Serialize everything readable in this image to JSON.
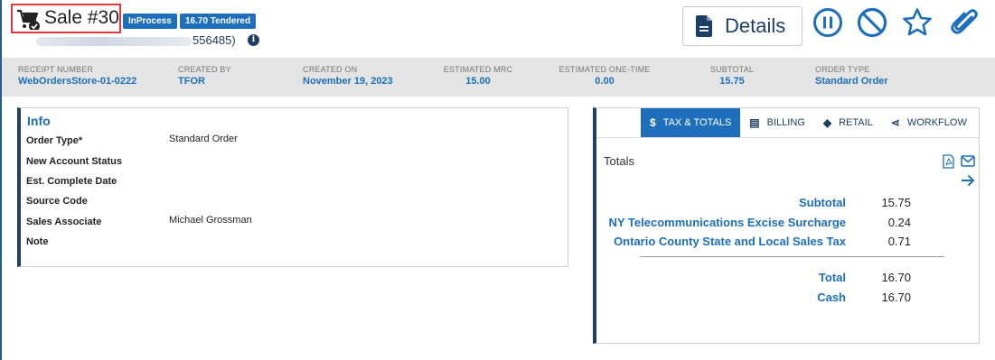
{
  "header": {
    "title": "Sale #30",
    "status_badge": "InProcess",
    "tendered_badge": "16.70 Tendered",
    "customer_suffix": "556485)",
    "details_label": "Details"
  },
  "summary": [
    {
      "label": "RECEIPT NUMBER",
      "value": "WebOrdersStore-01-0222"
    },
    {
      "label": "CREATED BY",
      "value": "TFOR"
    },
    {
      "label": "CREATED ON",
      "value": "November 19, 2023"
    },
    {
      "label": "ESTIMATED MRC",
      "value": "15.00"
    },
    {
      "label": "ESTIMATED ONE-TIME",
      "value": "0.00"
    },
    {
      "label": "SUBTOTAL",
      "value": "15.75"
    },
    {
      "label": "ORDER TYPE",
      "value": "Standard Order"
    }
  ],
  "info": {
    "title": "Info",
    "rows": [
      {
        "label": "Order Type*",
        "value": "Standard Order"
      },
      {
        "label": "New Account Status",
        "value": ""
      },
      {
        "label": "Est. Complete Date",
        "value": ""
      },
      {
        "label": "Source Code",
        "value": ""
      },
      {
        "label": "Sales Associate",
        "value": "Michael Grossman"
      },
      {
        "label": "Note",
        "value": ""
      }
    ]
  },
  "tabs": [
    {
      "icon": "$",
      "label": "TAX & TOTALS"
    },
    {
      "icon": "▤",
      "label": "BILLING"
    },
    {
      "icon": "◆",
      "label": "RETAIL"
    },
    {
      "icon": "⋖",
      "label": "WORKFLOW"
    }
  ],
  "totals": {
    "heading": "Totals",
    "lines": [
      {
        "label": "Subtotal",
        "value": "15.75"
      },
      {
        "label": "NY Telecommunications Excise Surcharge",
        "value": "0.24"
      },
      {
        "label": "Ontario County State and Local Sales Tax",
        "value": "0.71"
      }
    ],
    "summary_lines": [
      {
        "label": "Total",
        "value": "16.70"
      },
      {
        "label": "Cash",
        "value": "16.70"
      }
    ]
  },
  "colors": {
    "accent": "#1d6fbb",
    "navy": "#1d3f66",
    "highlight_box": "#e0393e"
  },
  "icons": [
    "cart-check-icon",
    "info-icon",
    "document-icon",
    "pause-icon",
    "block-icon",
    "star-icon",
    "paperclip-icon",
    "dollar-icon",
    "billing-icon",
    "tag-icon",
    "workflow-icon",
    "pdf-icon",
    "mail-icon",
    "arrow-right-icon"
  ]
}
